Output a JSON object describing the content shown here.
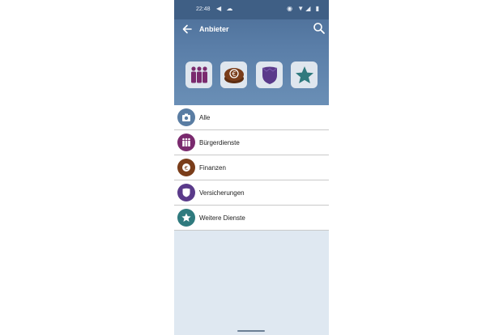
{
  "status": {
    "time": "22:48",
    "left_icons": "◀ ☁",
    "right_icons": "◉ ▼◢ ▮"
  },
  "appbar": {
    "title": "Anbieter"
  },
  "tiles": [
    {
      "name": "buergerdienste",
      "color": "#7a2a6e"
    },
    {
      "name": "finanzen",
      "color": "#7a3d1a"
    },
    {
      "name": "versicherungen",
      "color": "#5a3a8a"
    },
    {
      "name": "weitere-dienste",
      "color": "#2f7a7e"
    }
  ],
  "list": {
    "items": [
      {
        "label": "Alle",
        "color": "#5a7da3"
      },
      {
        "label": "Bürgerdienste",
        "color": "#7a2a6e"
      },
      {
        "label": "Finanzen",
        "color": "#7a3d1a"
      },
      {
        "label": "Versicherungen",
        "color": "#5a3a8a"
      },
      {
        "label": "Weitere Dienste",
        "color": "#2f7a7e"
      }
    ]
  }
}
